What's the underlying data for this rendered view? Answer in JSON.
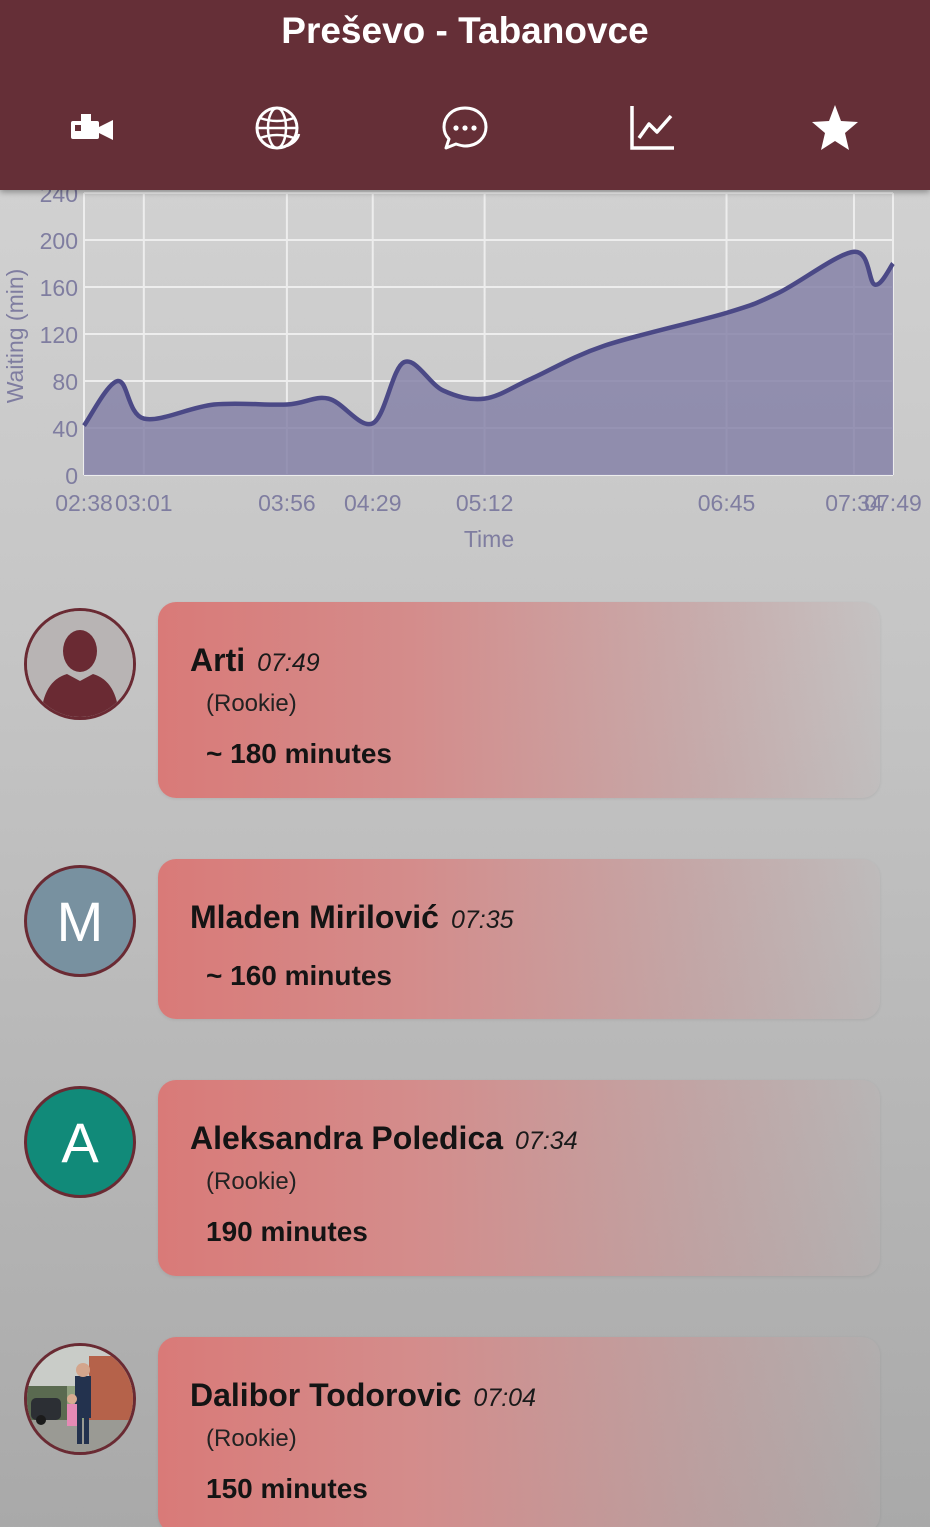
{
  "header": {
    "title": "Preševo - Tabanovce",
    "toolbar": [
      {
        "icon": "video-camera-icon"
      },
      {
        "icon": "globe-icon"
      },
      {
        "icon": "chat-bubble-icon"
      },
      {
        "icon": "line-chart-icon"
      },
      {
        "icon": "star-icon"
      }
    ]
  },
  "chart_data": {
    "type": "area",
    "x": [
      "02:38",
      "02:51",
      "03:01",
      "03:28",
      "03:56",
      "04:12",
      "04:29",
      "04:41",
      "04:56",
      "05:12",
      "05:30",
      "05:58",
      "06:45",
      "07:05",
      "07:34",
      "07:42",
      "07:49"
    ],
    "y": [
      42,
      80,
      48,
      60,
      60,
      65,
      44,
      96,
      72,
      65,
      82,
      110,
      138,
      155,
      190,
      162,
      180
    ],
    "xticks": [
      "02:38",
      "03:01",
      "03:56",
      "04:29",
      "05:12",
      "06:45",
      "07:34",
      "07:49"
    ],
    "yticks": [
      "0",
      "40",
      "80",
      "120",
      "160",
      "200",
      "240"
    ],
    "ylim": [
      0,
      240
    ],
    "xlabel": "Time",
    "ylabel": "Waiting (min)",
    "grid": true,
    "fill_color": "#8683a8",
    "line_color": "#4b4986"
  },
  "entries": [
    {
      "name": "Arti",
      "time": "07:49",
      "rank": "(Rookie)",
      "minutes": "~ 180 minutes",
      "avatar": "silhouette",
      "avatar_letter": ""
    },
    {
      "name": "Mladen Mirilović",
      "time": "07:35",
      "rank": "",
      "minutes": "~ 160 minutes",
      "avatar": "letter",
      "avatar_letter": "M",
      "avatar_color": "#7891a0"
    },
    {
      "name": "Aleksandra Poledica",
      "time": "07:34",
      "rank": "(Rookie)",
      "minutes": "190 minutes",
      "avatar": "letter",
      "avatar_letter": "A",
      "avatar_color": "#118a79"
    },
    {
      "name": "Dalibor Todorovic",
      "time": "07:04",
      "rank": "(Rookie)",
      "minutes": "150 minutes",
      "avatar": "photo",
      "avatar_letter": ""
    }
  ]
}
